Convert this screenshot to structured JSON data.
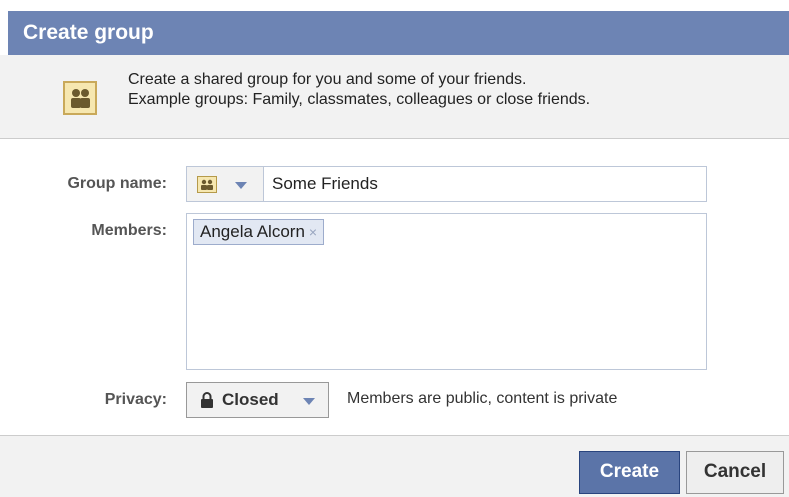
{
  "dialog": {
    "title": "Create group",
    "intro_line1": "Create a shared group for you and some of your friends.",
    "intro_line2": "Example groups: Family, classmates, colleagues or close friends."
  },
  "form": {
    "group_name_label": "Group name:",
    "group_name_value": "Some Friends",
    "members_label": "Members:",
    "members": [
      {
        "name": "Angela Alcorn",
        "remove": "×"
      }
    ],
    "privacy_label": "Privacy:",
    "privacy_value": "Closed",
    "privacy_description": "Members are public, content is private"
  },
  "buttons": {
    "create": "Create",
    "cancel": "Cancel"
  },
  "icons": {
    "group": "group-people-icon",
    "lock": "lock-icon",
    "caret": "chevron-down-icon",
    "remove": "remove-x-icon"
  },
  "colors": {
    "title_bar": "#6d84b4",
    "primary_button": "#5b74a8",
    "token_bg": "#e2e8f3",
    "panel_bg": "#f2f2f2"
  }
}
